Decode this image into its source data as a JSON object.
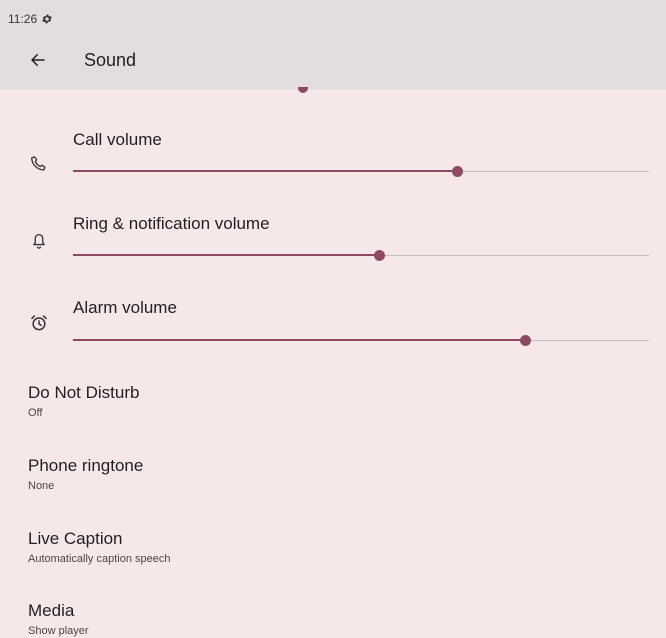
{
  "status_bar": {
    "time": "11:26",
    "icon": "gear-icon"
  },
  "header": {
    "title": "Sound",
    "back_icon": "arrow-left-icon"
  },
  "volumes": [
    {
      "label": "Call volume",
      "icon": "phone-icon",
      "level": 0.667
    },
    {
      "label": "Ring & notification volume",
      "icon": "bell-icon",
      "level": 0.532
    },
    {
      "label": "Alarm volume",
      "icon": "alarm-clock-icon",
      "level": 0.785
    }
  ],
  "preferences": [
    {
      "title": "Do Not Disturb",
      "summary": "Off"
    },
    {
      "title": "Phone ringtone",
      "summary": "None"
    },
    {
      "title": "Live Caption",
      "summary": "Automatically caption speech"
    },
    {
      "title": "Media",
      "summary": "Show player"
    }
  ],
  "colors": {
    "accent": "#8d4b63",
    "background": "#f6e7e8",
    "appbar": "#e4dddd"
  }
}
